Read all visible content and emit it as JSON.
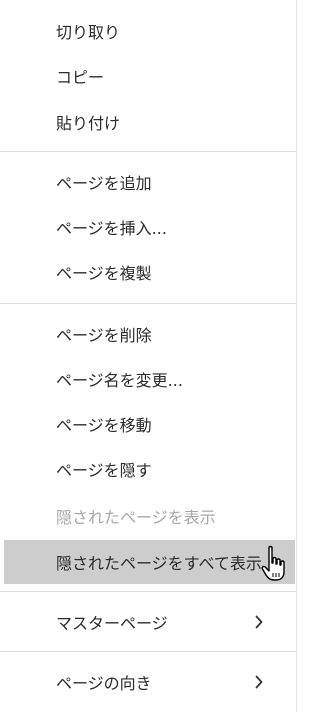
{
  "menu": {
    "items": [
      {
        "label": "切り取り"
      },
      {
        "label": "コピー"
      },
      {
        "label": "貼り付け"
      },
      {
        "label": "ページを追加"
      },
      {
        "label": "ページを挿入..."
      },
      {
        "label": "ページを複製"
      },
      {
        "label": "ページを削除"
      },
      {
        "label": "ページ名を変更..."
      },
      {
        "label": "ページを移動"
      },
      {
        "label": "ページを隠す"
      },
      {
        "label": "隠されたページを表示"
      },
      {
        "label": "隠されたページをすべて表示"
      },
      {
        "label": "マスターページ"
      },
      {
        "label": "ページの向き"
      }
    ]
  },
  "colors": {
    "hover_bg": "#cdcdcd",
    "disabled_text": "#a8a8a8",
    "separator": "#dedede"
  },
  "icons": {
    "submenu": "chevron-right-icon",
    "cursor": "hand-pointer-icon"
  }
}
